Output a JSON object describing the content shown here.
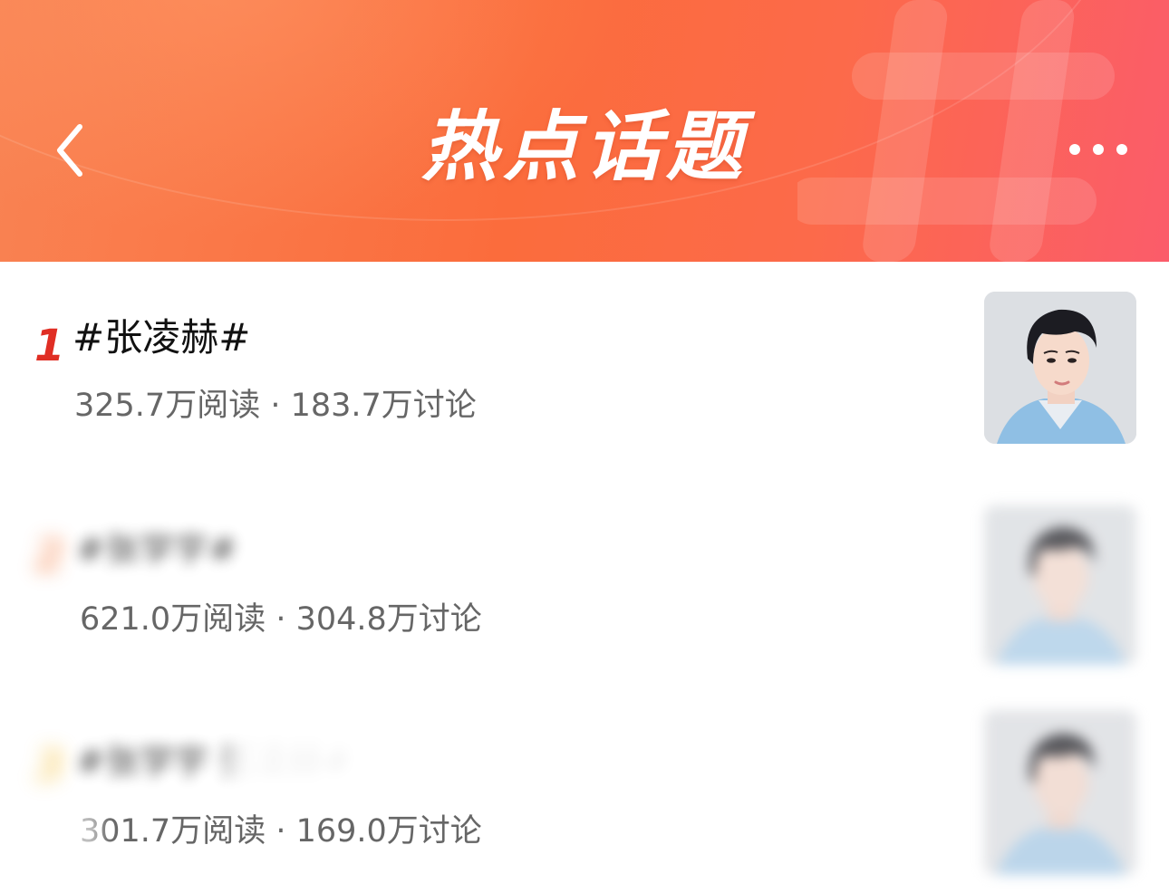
{
  "header": {
    "title": "热点话题",
    "back_icon": "chevron-left-icon",
    "more_icon": "more-dots-icon",
    "colors": {
      "gradient_start": "#f98353",
      "gradient_end": "#fb5c6a",
      "title": "#ffffff"
    }
  },
  "topics": [
    {
      "rank": "1",
      "title": "#张凌赫#",
      "stats": "325.7万阅读 · 183.7万讨论",
      "rank_color": "#e02e24",
      "blurred": false
    },
    {
      "rank": "2",
      "title": "#张学宇#",
      "stats": "621.0万阅读 · 304.8万讨论",
      "rank_color": "#f47a3c",
      "blurred": true
    },
    {
      "rank": "3",
      "title": "#张学宇 张凌赫#",
      "stats": "301.7万阅读 · 169.0万讨论",
      "rank_color": "#f5c242",
      "blurred": true
    }
  ]
}
